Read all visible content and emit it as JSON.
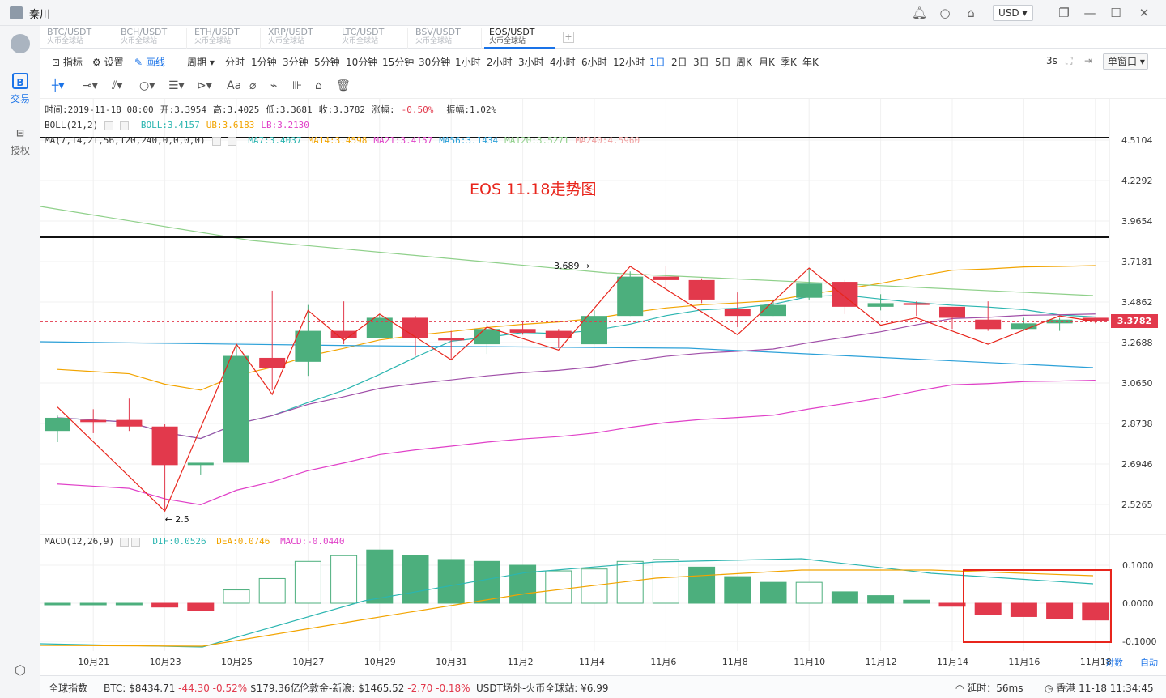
{
  "user": {
    "name": "秦川"
  },
  "currency": "USD",
  "sidebar": [
    {
      "label": "交易",
      "icon": "B"
    },
    {
      "label": "授权",
      "icon": "key"
    }
  ],
  "tabs": [
    {
      "pair": "BTC/USDT",
      "sub": "火币全球站"
    },
    {
      "pair": "BCH/USDT",
      "sub": "火币全球站"
    },
    {
      "pair": "ETH/USDT",
      "sub": "火币全球站"
    },
    {
      "pair": "XRP/USDT",
      "sub": "火币全球站"
    },
    {
      "pair": "LTC/USDT",
      "sub": "火币全球站"
    },
    {
      "pair": "BSV/USDT",
      "sub": "火币全球站"
    },
    {
      "pair": "EOS/USDT",
      "sub": "火币全球站",
      "active": true
    }
  ],
  "toolbar": {
    "indicator": "指标",
    "settings": "设置",
    "draw": "画线",
    "period": "周期"
  },
  "periods": [
    "分时",
    "1分钟",
    "3分钟",
    "5分钟",
    "10分钟",
    "15分钟",
    "30分钟",
    "1小时",
    "2小时",
    "3小时",
    "4小时",
    "6小时",
    "12小时",
    "1日",
    "2日",
    "3日",
    "5日",
    "周K",
    "月K",
    "季K",
    "年K"
  ],
  "active_period": "1日",
  "refresh": "3s",
  "window_mode": "单窗口",
  "info": {
    "time": "时间:2019-11-18 08:00",
    "open": "开:3.3954",
    "high": "高:3.4025",
    "low": "低:3.3681",
    "close": "收:3.3782",
    "change_label": "涨幅:",
    "change": "-0.50%",
    "amplitude": "振幅:1.02%"
  },
  "boll": {
    "label": "BOLL(21,2)",
    "mid": "BOLL:3.4157",
    "ub": "UB:3.6183",
    "lb": "LB:3.2130"
  },
  "ma": {
    "label": "MA(7,14,21,56,120,240,0,0,0,0)",
    "ma7": "MA7:3.4037",
    "ma14": "MA14:3.4598",
    "ma21": "MA21:3.4157",
    "ma56": "MA56:3.1434",
    "ma120": "MA120:3.5271",
    "ma240": "MA240:4.5960"
  },
  "macd": {
    "label": "MACD(12,26,9)",
    "dif": "DIF:0.0526",
    "dea": "DEA:0.0746",
    "macd": "MACD:-0.0440"
  },
  "annotation_title": "EOS 11.18走势图",
  "marker_high": "3.689",
  "marker_low": "2.5",
  "last_price": "3.3782",
  "axis_labels": {
    "adjust": "对数",
    "auto": "自动"
  },
  "chart_data": {
    "type": "candlestick",
    "title": "EOS 11.18走势图",
    "price_ticks": [
      4.5104,
      4.2292,
      3.9654,
      3.7181,
      3.4862,
      3.2688,
      3.065,
      2.8738,
      2.6946,
      2.5265
    ],
    "macd_ticks": [
      0.1,
      0.0,
      -0.1
    ],
    "x_tick_labels": [
      "10月21",
      "10月23",
      "10月25",
      "10月27",
      "10月29",
      "10月31",
      "11月2",
      "11月4",
      "11月6",
      "11月8",
      "11月10",
      "11月12",
      "11月14",
      "11月16",
      "11月18"
    ],
    "dates": [
      "10-20",
      "10-21",
      "10-22",
      "10-23",
      "10-24",
      "10-25",
      "10-26",
      "10-27",
      "10-28",
      "10-29",
      "10-30",
      "10-31",
      "11-01",
      "11-02",
      "11-03",
      "11-04",
      "11-05",
      "11-06",
      "11-07",
      "11-08",
      "11-09",
      "11-10",
      "11-11",
      "11-12",
      "11-13",
      "11-14",
      "11-15",
      "11-16",
      "11-17",
      "11-18"
    ],
    "candles": [
      {
        "o": 2.84,
        "h": 2.91,
        "l": 2.79,
        "c": 2.9
      },
      {
        "o": 2.89,
        "h": 2.94,
        "l": 2.83,
        "c": 2.88
      },
      {
        "o": 2.89,
        "h": 2.99,
        "l": 2.84,
        "c": 2.86
      },
      {
        "o": 2.86,
        "h": 2.87,
        "l": 2.5,
        "c": 2.69
      },
      {
        "o": 2.69,
        "h": 2.7,
        "l": 2.65,
        "c": 2.7
      },
      {
        "o": 2.7,
        "h": 3.26,
        "l": 2.7,
        "c": 3.2
      },
      {
        "o": 3.19,
        "h": 3.55,
        "l": 3.03,
        "c": 3.14
      },
      {
        "o": 3.17,
        "h": 3.47,
        "l": 3.1,
        "c": 3.33
      },
      {
        "o": 3.33,
        "h": 3.49,
        "l": 3.26,
        "c": 3.29
      },
      {
        "o": 3.29,
        "h": 3.42,
        "l": 3.29,
        "c": 3.4
      },
      {
        "o": 3.4,
        "h": 3.41,
        "l": 3.2,
        "c": 3.29
      },
      {
        "o": 3.29,
        "h": 3.33,
        "l": 3.18,
        "c": 3.28
      },
      {
        "o": 3.26,
        "h": 3.37,
        "l": 3.21,
        "c": 3.34
      },
      {
        "o": 3.34,
        "h": 3.38,
        "l": 3.31,
        "c": 3.32
      },
      {
        "o": 3.33,
        "h": 3.34,
        "l": 3.24,
        "c": 3.29
      },
      {
        "o": 3.26,
        "h": 3.44,
        "l": 3.26,
        "c": 3.41
      },
      {
        "o": 3.41,
        "h": 3.66,
        "l": 3.41,
        "c": 3.63
      },
      {
        "o": 3.63,
        "h": 3.69,
        "l": 3.56,
        "c": 3.61
      },
      {
        "o": 3.61,
        "h": 3.62,
        "l": 3.48,
        "c": 3.5
      },
      {
        "o": 3.45,
        "h": 3.54,
        "l": 3.35,
        "c": 3.41
      },
      {
        "o": 3.41,
        "h": 3.5,
        "l": 3.41,
        "c": 3.47
      },
      {
        "o": 3.51,
        "h": 3.68,
        "l": 3.5,
        "c": 3.59
      },
      {
        "o": 3.6,
        "h": 3.61,
        "l": 3.42,
        "c": 3.46
      },
      {
        "o": 3.46,
        "h": 3.53,
        "l": 3.44,
        "c": 3.48
      },
      {
        "o": 3.48,
        "h": 3.49,
        "l": 3.41,
        "c": 3.47
      },
      {
        "o": 3.46,
        "h": 3.45,
        "l": 3.34,
        "c": 3.4
      },
      {
        "o": 3.39,
        "h": 3.49,
        "l": 3.33,
        "c": 3.34
      },
      {
        "o": 3.34,
        "h": 3.4,
        "l": 3.33,
        "c": 3.37
      },
      {
        "o": 3.37,
        "h": 3.4,
        "l": 3.33,
        "c": 3.39
      },
      {
        "o": 3.4,
        "h": 3.4,
        "l": 3.37,
        "c": 3.38
      }
    ],
    "macd_hist": [
      0.0,
      0.0,
      0.0,
      -0.01,
      -0.02,
      0.035,
      0.065,
      0.11,
      0.125,
      0.14,
      0.125,
      0.115,
      0.11,
      0.1,
      0.085,
      0.09,
      0.11,
      0.115,
      0.095,
      0.07,
      0.055,
      0.055,
      0.03,
      0.02,
      0.008,
      -0.008,
      -0.03,
      -0.035,
      -0.04,
      -0.044
    ]
  }
}
